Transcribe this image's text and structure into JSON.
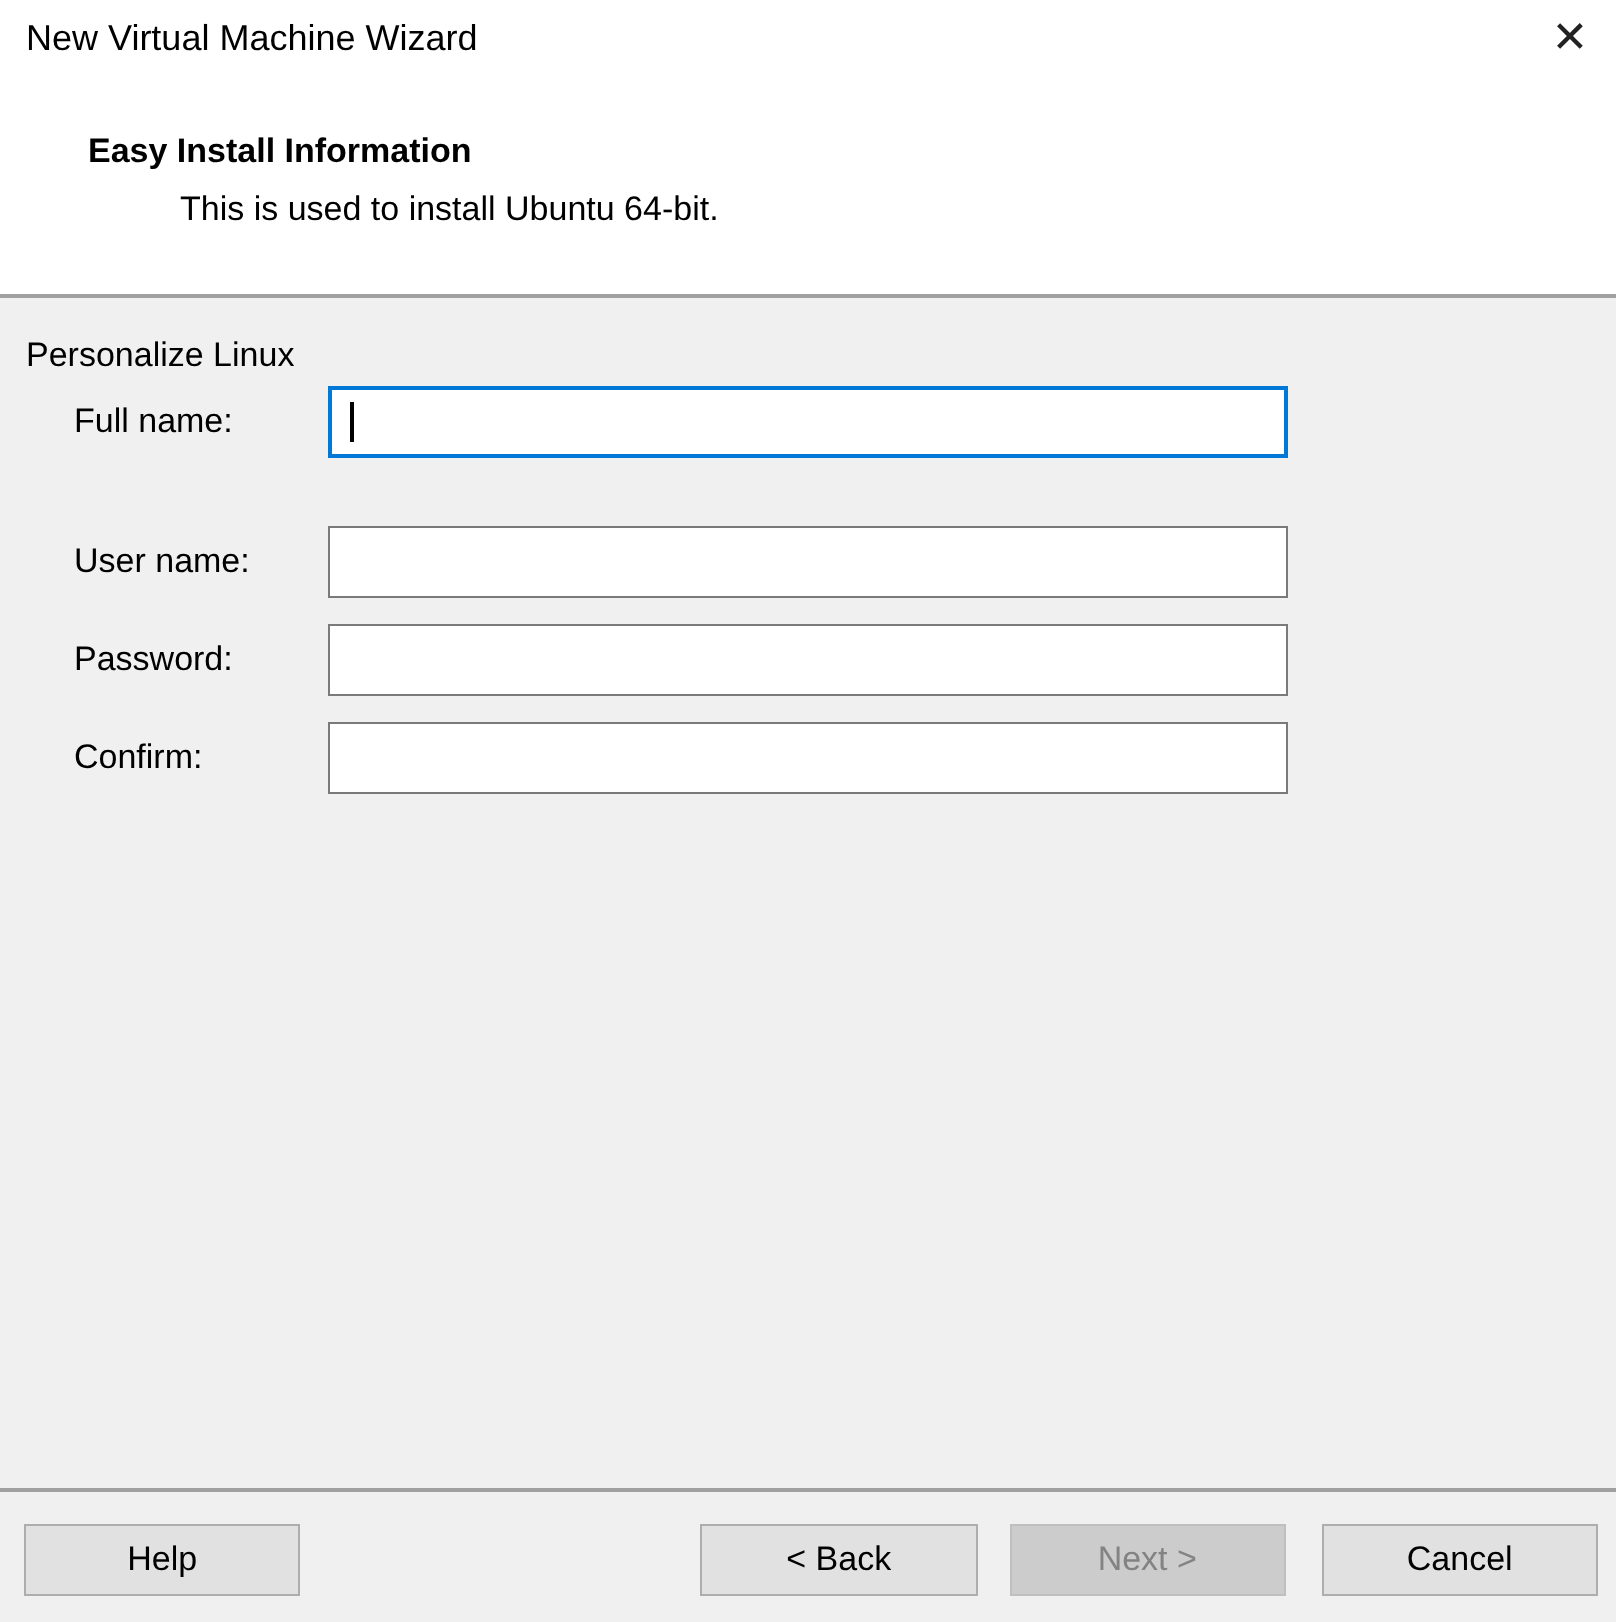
{
  "window": {
    "title": "New Virtual Machine Wizard",
    "close": "✕"
  },
  "header": {
    "title": "Easy Install Information",
    "subtitle": "This is used to install Ubuntu 64-bit."
  },
  "group": {
    "title": "Personalize Linux",
    "fields": [
      {
        "label": "Full name:",
        "focused": true
      },
      {
        "label": "User name:",
        "focused": false
      },
      {
        "label": "Password:",
        "focused": false
      },
      {
        "label": "Confirm:",
        "focused": false
      }
    ]
  },
  "buttons": [
    {
      "label": "Help",
      "disabled": false,
      "kind": "left"
    },
    {
      "label": "< Back",
      "disabled": false,
      "kind": "right"
    },
    {
      "label": "Next >",
      "disabled": true,
      "kind": "right"
    },
    {
      "label": "Cancel",
      "disabled": false,
      "kind": "far"
    }
  ]
}
